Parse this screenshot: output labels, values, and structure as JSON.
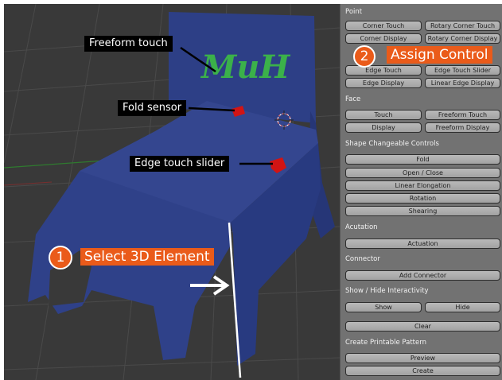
{
  "viewport": {
    "labels": {
      "freeform_touch": "Freeform touch",
      "fold_sensor": "Fold sensor",
      "edge_touch_slider": "Edge touch slider"
    },
    "drawn_text": "MuH",
    "step1": {
      "number": "1",
      "text": "Select 3D Element"
    },
    "step2": {
      "number": "2",
      "text": "Assign Control"
    }
  },
  "panel": {
    "point": {
      "title": "Point",
      "buttons": [
        "Corner Touch",
        "Rotary Corner Touch",
        "Corner Display",
        "Rotary Corner Display",
        "Edge Touch",
        "Edge Touch Slider",
        "Edge Display",
        "Linear Edge Display"
      ]
    },
    "face": {
      "title": "Face",
      "buttons": [
        "Touch",
        "Freeform Touch",
        "Display",
        "Freeform Display"
      ]
    },
    "shape": {
      "title": "Shape Changeable Controls",
      "buttons": [
        "Fold",
        "Open / Close",
        "Linear Elongation",
        "Rotation",
        "Shearing"
      ]
    },
    "actuation": {
      "title": "Acutation",
      "button": "Actuation"
    },
    "connector": {
      "title": "Connector",
      "button": "Add Connector"
    },
    "interactivity": {
      "title": "Show / Hide Interactivity",
      "show": "Show",
      "hide": "Hide",
      "clear": "Clear"
    },
    "pattern": {
      "title": "Create Printable Pattern",
      "preview": "Preview",
      "create": "Create"
    }
  },
  "colors": {
    "model_blue": "#2f4189",
    "accent_orange": "#ea5b1a",
    "green_stroke": "#3bb14a",
    "sensor_red": "#d21414"
  }
}
